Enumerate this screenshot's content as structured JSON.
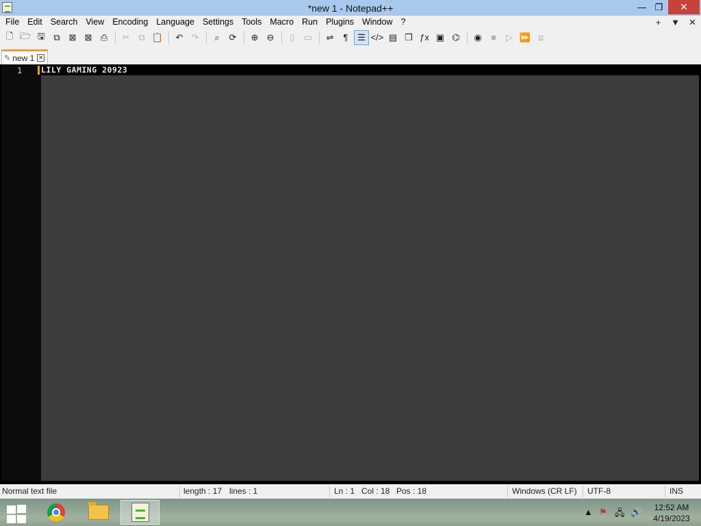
{
  "window": {
    "title": "*new 1 - Notepad++",
    "minimize_glyph": "—",
    "restore_glyph": "❐",
    "close_glyph": "✕"
  },
  "menu": {
    "items": [
      "File",
      "Edit",
      "Search",
      "View",
      "Encoding",
      "Language",
      "Settings",
      "Tools",
      "Macro",
      "Run",
      "Plugins",
      "Window",
      "?"
    ],
    "right_controls": [
      "+",
      "▼",
      "✕"
    ]
  },
  "toolbar": {
    "icons": [
      "new-file-icon",
      "open-folder-icon",
      "save-icon",
      "save-all-icon",
      "close-icon",
      "close-all-icon",
      "print-icon",
      "cut-icon",
      "copy-icon",
      "paste-icon",
      "undo-icon",
      "redo-icon",
      "find-icon",
      "replace-icon",
      "zoom-in-icon",
      "zoom-out-icon",
      "sync-vertical-icon",
      "sync-horizontal-icon",
      "word-wrap-icon",
      "show-all-chars-icon",
      "indent-guide-icon",
      "xml-tag-icon",
      "doc-map-icon",
      "doc-list-icon",
      "function-list-icon",
      "monitor-icon",
      "folder-workspace-icon",
      "record-macro-icon",
      "stop-macro-icon",
      "play-macro-icon",
      "run-macro-multiple-icon",
      "save-macro-icon"
    ]
  },
  "tabs": [
    {
      "label": "new 1",
      "modified": true
    }
  ],
  "editor": {
    "lines": [
      {
        "number": "1",
        "text": "LILY GAMING 20923"
      }
    ],
    "theme": {
      "background": "#3c3c3c",
      "gutter": "#0c0c0c",
      "caret": "#f29b3a"
    }
  },
  "status": {
    "file_type": "Normal text file",
    "length": "length : 17",
    "lines": "lines : 1",
    "ln": "Ln : 1",
    "col": "Col : 18",
    "pos": "Pos : 18",
    "eol": "Windows (CR LF)",
    "encoding": "UTF-8",
    "mode": "INS"
  },
  "taskbar": {
    "apps": [
      "start-icon",
      "chrome-icon",
      "file-explorer-icon",
      "notepad-plus-plus-icon"
    ],
    "tray": [
      "show-hidden-icons",
      "action-center-flag-icon",
      "network-icon",
      "volume-icon"
    ],
    "clock_time": "12:52 AM",
    "clock_date": "4/19/2023"
  }
}
